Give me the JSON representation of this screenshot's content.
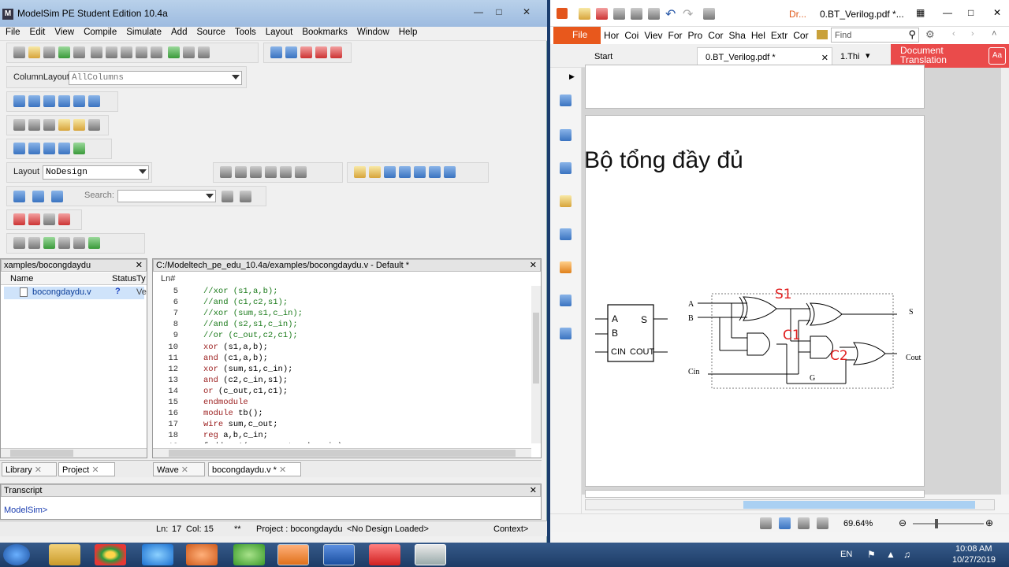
{
  "modelsim": {
    "title": "ModelSim PE Student Edition 10.4a",
    "menu": [
      "File",
      "Edit",
      "View",
      "Compile",
      "Simulate",
      "Add",
      "Source",
      "Tools",
      "Layout",
      "Bookmarks",
      "Window",
      "Help"
    ],
    "column_layout_label": "ColumnLayout",
    "column_layout_value": "AllColumns",
    "layout_label": "Layout",
    "layout_value": "NoDesign",
    "search_label": "Search:",
    "library_pane": {
      "title": "xamples/bocongdaydu",
      "col_name": "Name",
      "col_status": "Status",
      "col_type": "Ty",
      "file": "bocongdaydu.v",
      "file_status": "?",
      "file_type": "Ve"
    },
    "editor_pane": {
      "title": "C:/Modeltech_pe_edu_10.4a/examples/bocongdaydu.v - Default *",
      "col_ln": "Ln#",
      "lines": [
        {
          "n": "5",
          "text": "//xor (s1,a,b);",
          "kind": "cmt"
        },
        {
          "n": "6",
          "text": "//and (c1,c2,s1);",
          "kind": "cmt"
        },
        {
          "n": "7",
          "text": "//xor (sum,s1,c_in);",
          "kind": "cmt"
        },
        {
          "n": "8",
          "text": "//and (s2,s1,c_in);",
          "kind": "cmt"
        },
        {
          "n": "9",
          "text": "//or (c_out,c2,c1);",
          "kind": "cmt"
        },
        {
          "n": "10",
          "kw": "xor",
          "text": " (s1,a,b);",
          "kind": "kw"
        },
        {
          "n": "11",
          "kw": "and",
          "text": " (c1,a,b);",
          "kind": "kw"
        },
        {
          "n": "12",
          "kw": "xor",
          "text": " (sum,s1,c_in);",
          "kind": "kw"
        },
        {
          "n": "13",
          "kw": "and",
          "text": " (c2,c_in,s1);",
          "kind": "kw"
        },
        {
          "n": "14",
          "kw": "or",
          "text": " (c_out,c1,c1);",
          "kind": "kw"
        },
        {
          "n": "15",
          "kw": "endmodule",
          "text": "",
          "kind": "kw"
        },
        {
          "n": "16",
          "kw": "module",
          "text": " tb();",
          "kind": "kw"
        },
        {
          "n": "17",
          "kw": "wire",
          "text": " sum,c_out;",
          "kind": "kw"
        },
        {
          "n": "18",
          "kw": "reg",
          "text": " a,b,c_in;",
          "kind": "kw"
        },
        {
          "n": "19",
          "text": "fadder A(sum,c_out,a,b,c_in);",
          "kind": "tx"
        }
      ]
    },
    "bottom_tabs": {
      "library": "Library",
      "project": "Project",
      "wave": "Wave",
      "file": "bocongdaydu.v *"
    },
    "transcript": {
      "title": "Transcript",
      "prompt": "ModelSim>"
    },
    "status": {
      "ln": "Ln:",
      "ln_val": "17",
      "col": "Col: 15",
      "marks": "**",
      "project": "Project : bocongdaydu",
      "design": "<No Design Loaded>",
      "context": "Context>"
    }
  },
  "pdf": {
    "quick_tab": "Dr...",
    "title": "0.BT_Verilog.pdf *...",
    "ribbon": {
      "file": "File",
      "items": [
        "Hor",
        "Coi",
        "Viev",
        "For",
        "Pro",
        "Cor",
        "Sha",
        "Hel",
        "Extr",
        "Cor"
      ],
      "find_placeholder": "Find"
    },
    "tabs": {
      "start": "Start",
      "doc": "0.BT_Verilog.pdf *",
      "third": "1.Thi"
    },
    "translation": {
      "line1": "Document",
      "line2": "Translation"
    },
    "page_heading": "Bộ tổng đầy đủ",
    "block": {
      "a": "A",
      "b": "B",
      "s": "S",
      "cin": "CIN",
      "cout": "COUT"
    },
    "circuit": {
      "a": "A",
      "b": "B",
      "cin": "Cin",
      "s": "S",
      "cout": "Cout",
      "g": "G"
    },
    "handwritten": {
      "s1": "S1",
      "c1": "C1",
      "c2": "C2"
    },
    "zoom": "69.64%"
  },
  "taskbar": {
    "lang": "EN",
    "time": "10:08 AM",
    "date": "10/27/2019"
  }
}
